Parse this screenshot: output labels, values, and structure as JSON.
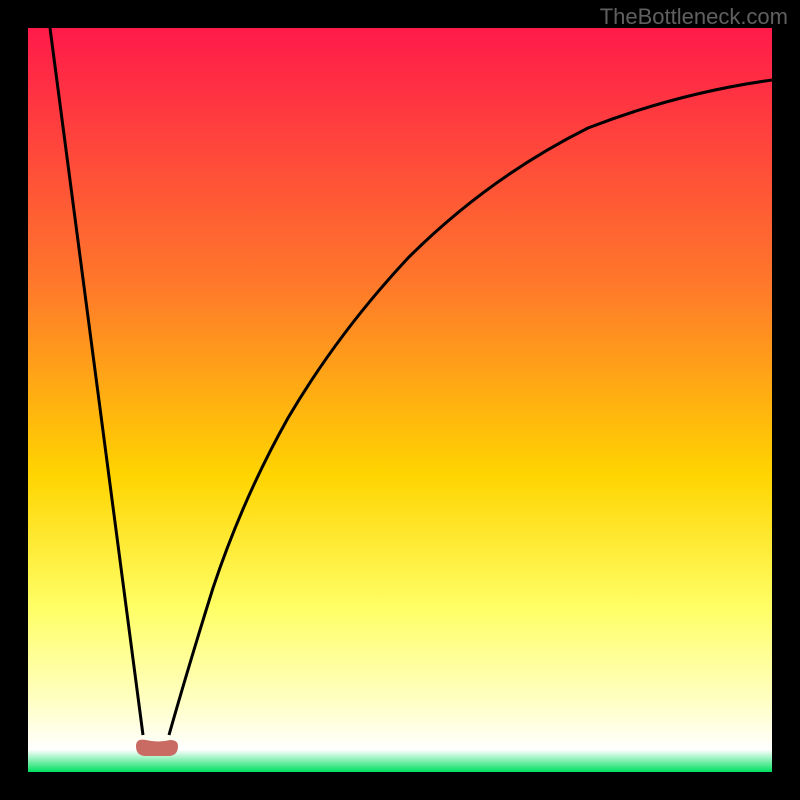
{
  "watermark": "TheBottleneck.com",
  "chart_data": {
    "type": "line",
    "title": "",
    "xlabel": "",
    "ylabel": "",
    "xlim": [
      0,
      100
    ],
    "ylim": [
      0,
      100
    ],
    "gradient_stops": [
      {
        "offset": 0,
        "color": "#ff1a4a"
      },
      {
        "offset": 35,
        "color": "#ff7a2a"
      },
      {
        "offset": 60,
        "color": "#ffd400"
      },
      {
        "offset": 78,
        "color": "#ffff66"
      },
      {
        "offset": 90,
        "color": "#ffffc0"
      },
      {
        "offset": 97,
        "color": "#ffffff"
      },
      {
        "offset": 100,
        "color": "#00e060"
      }
    ],
    "series": [
      {
        "name": "left-descent",
        "x": [
          3,
          15.5
        ],
        "y": [
          100,
          5
        ]
      },
      {
        "name": "right-rise",
        "x": [
          19,
          22,
          26,
          30,
          35,
          40,
          45,
          52,
          60,
          70,
          80,
          90,
          100
        ],
        "y": [
          5,
          14,
          25,
          35,
          45,
          54,
          61,
          69,
          76,
          83,
          88,
          91,
          93
        ]
      }
    ],
    "bottom_marker": {
      "name": "bottom-blob",
      "color": "#c96a63",
      "x_range": [
        14,
        20
      ],
      "y": 3.5
    }
  }
}
